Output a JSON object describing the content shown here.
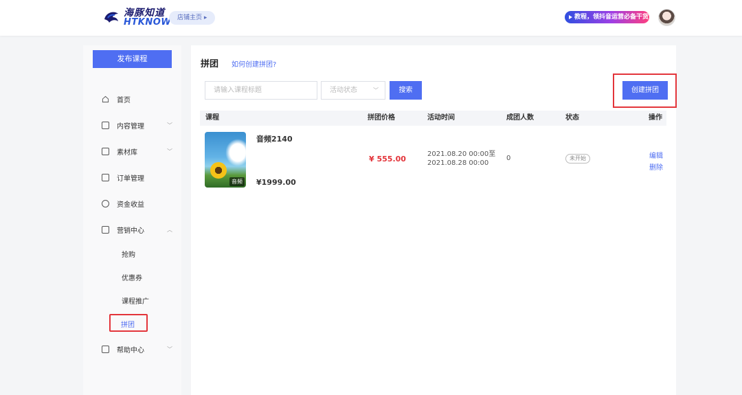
{
  "header": {
    "logo_cn": "海豚知道",
    "logo_en": "HTKNOW",
    "shop_link": "店铺主页 ▸",
    "promo": "教程，领抖音运营必备干货"
  },
  "sidebar": {
    "publish_button": "发布课程",
    "items": [
      {
        "label": "首页"
      },
      {
        "label": "内容管理",
        "chevron": "﹀"
      },
      {
        "label": "素材库",
        "chevron": "﹀"
      },
      {
        "label": "订单管理"
      },
      {
        "label": "资金收益"
      },
      {
        "label": "营销中心",
        "chevron": "︿"
      },
      {
        "label": "帮助中心",
        "chevron": "﹀"
      }
    ],
    "sub_items": [
      {
        "label": "抢购"
      },
      {
        "label": "优惠券"
      },
      {
        "label": "课程推广"
      },
      {
        "label": "拼团"
      }
    ]
  },
  "main": {
    "title": "拼团",
    "help_link": "如何创建拼团?",
    "search_placeholder": "请输入课程标题",
    "status_placeholder": "活动状态",
    "search_button": "搜索",
    "create_button": "创建拼团",
    "columns": [
      "课程",
      "拼团价格",
      "活动时间",
      "成团人数",
      "状态",
      "操作"
    ],
    "rows": [
      {
        "thumb_tag": "音频",
        "title": "音频2140",
        "price": "¥1999.00",
        "group_price": "¥ 555.00",
        "time": "2021.08.20 00:00至2021.08.28 00:00",
        "count": "0",
        "status": "未开始",
        "op_edit": "编辑",
        "op_delete": "删除"
      }
    ]
  }
}
